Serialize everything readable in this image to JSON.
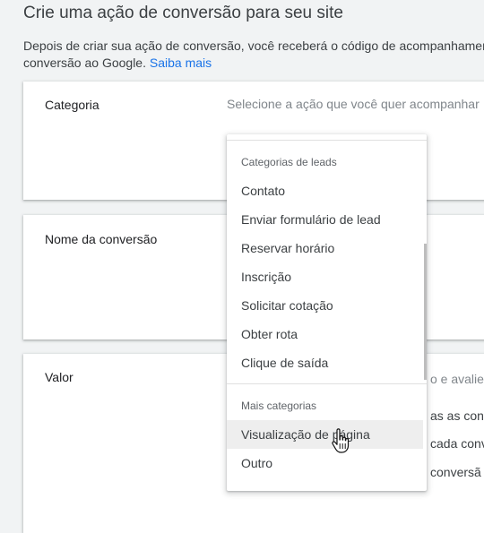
{
  "page": {
    "title": "Crie uma ação de conversão para seu site",
    "intro_line1": "Depois de criar sua ação de conversão, você receberá o código de acompanhamento",
    "intro_line2": "conversão ao Google. ",
    "learn_more": "Saiba mais"
  },
  "category_card": {
    "label": "Categoria",
    "placeholder": "Selecione a ação que você quer acompanhar"
  },
  "name_card": {
    "label": "Nome da conversão"
  },
  "value_card": {
    "label": "Valor",
    "line1": "o e avalie",
    "line2": "as as con",
    "line3": "cada conv",
    "line4": "conversã"
  },
  "dropdown": {
    "lead_header": "Categorias de leads",
    "lead_items": [
      "Contato",
      "Enviar formulário de lead",
      "Reservar horário",
      "Inscrição",
      "Solicitar cotação",
      "Obter rota",
      "Clique de saída"
    ],
    "more_header": "Mais categorias",
    "more_items": [
      "Visualização de página",
      "Outro"
    ],
    "hovered_item": "Visualização de página"
  },
  "icons": {
    "cursor": "hand-pointer-icon"
  }
}
